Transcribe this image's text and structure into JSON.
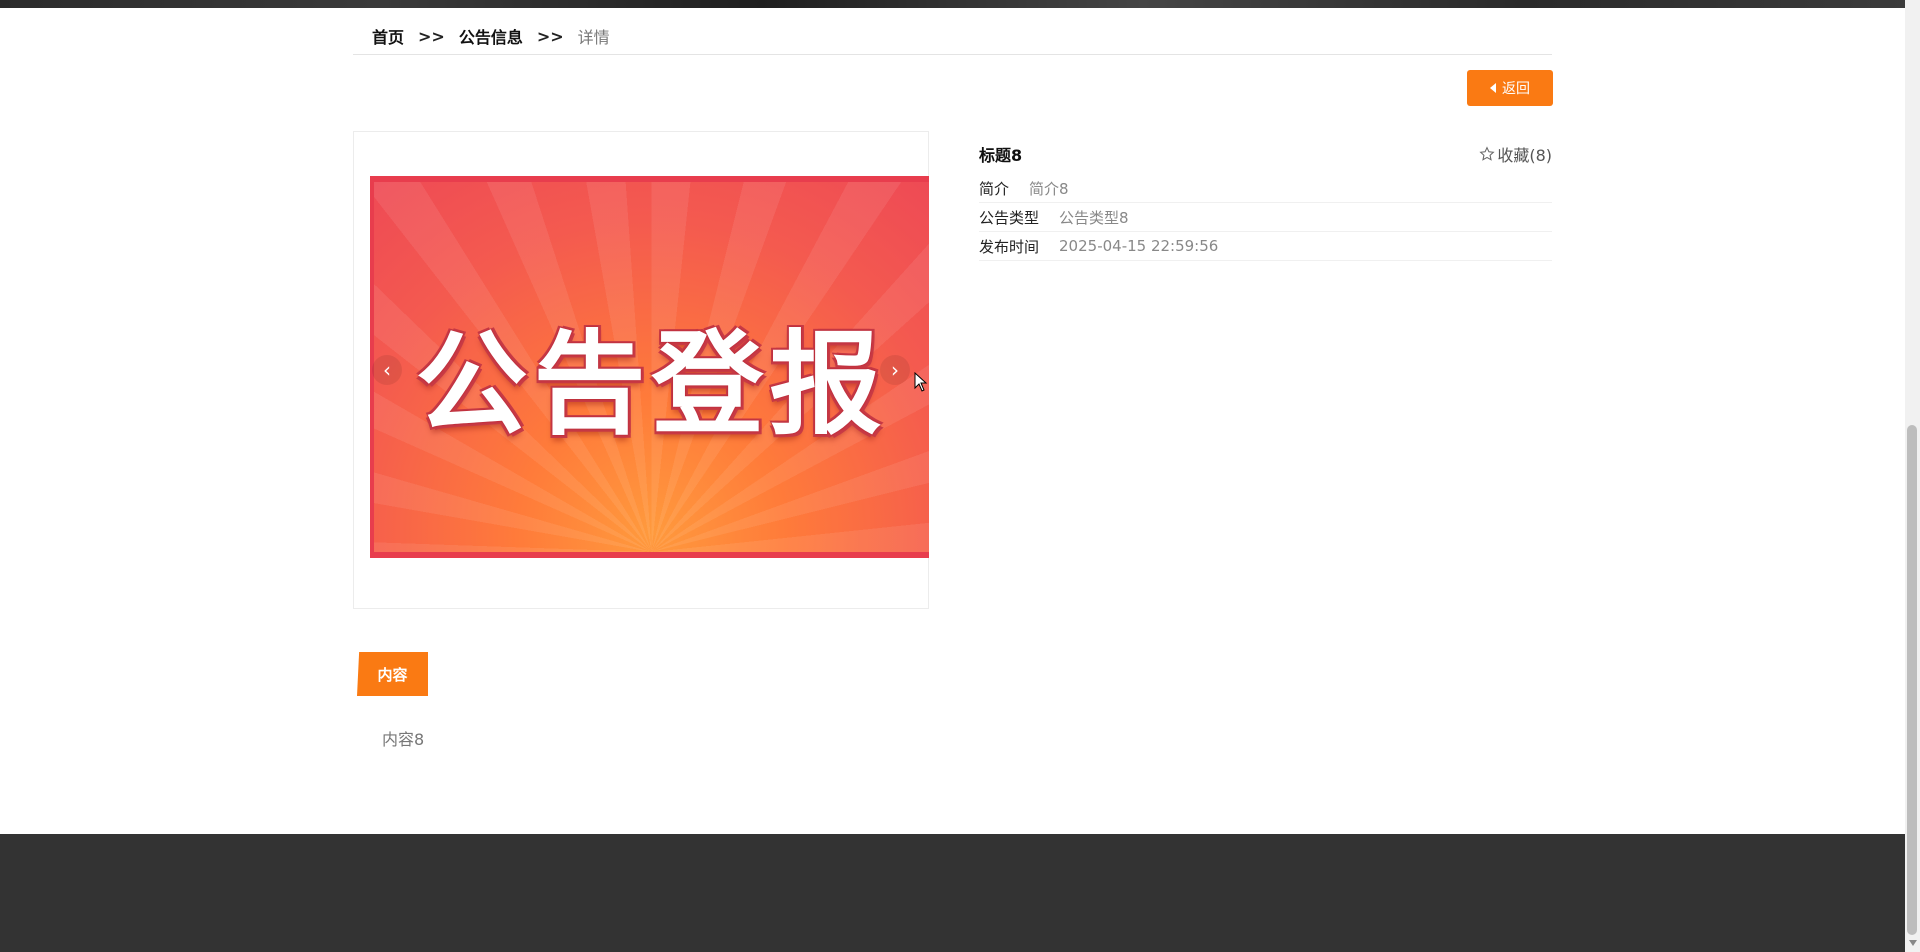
{
  "breadcrumb": {
    "home": "首页",
    "separator": ">>",
    "section": "公告信息",
    "current": "详情"
  },
  "back_button": {
    "label": "返回"
  },
  "gallery": {
    "poster_text": "公告登报",
    "prev_arrow": "‹",
    "next_arrow": "›"
  },
  "info": {
    "title": "标题8",
    "favorite": "收藏(8)",
    "rows": [
      {
        "label": "简介",
        "value": "简介8"
      },
      {
        "label": "公告类型",
        "value": "公告类型8"
      },
      {
        "label": "发布时间",
        "value": "2025-04-15 22:59:56"
      }
    ]
  },
  "tabs": {
    "content_tab": "内容"
  },
  "content": {
    "text": "内容8"
  },
  "colors": {
    "accent": "#fa7a13",
    "footer": "#333333"
  }
}
